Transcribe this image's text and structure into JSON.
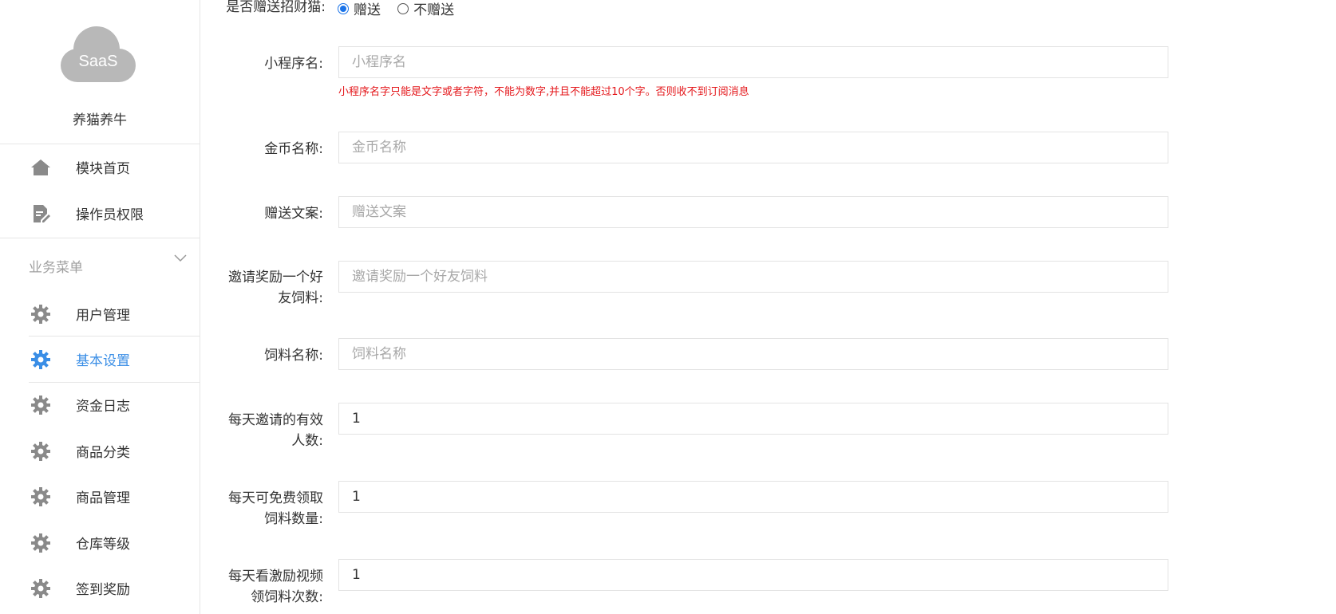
{
  "sidebar": {
    "logo_text": "SaaS",
    "app_name": "养猫养牛",
    "top_items": [
      {
        "label": "模块首页",
        "icon": "home-icon"
      },
      {
        "label": "操作员权限",
        "icon": "document-edit-icon"
      }
    ],
    "group": {
      "label": "业务菜单",
      "icon": "chevron-down-icon"
    },
    "items": [
      {
        "label": "用户管理",
        "icon": "gear-icon",
        "active": false
      },
      {
        "label": "基本设置",
        "icon": "gear-icon",
        "active": true
      },
      {
        "label": "资金日志",
        "icon": "gear-icon",
        "active": false
      },
      {
        "label": "商品分类",
        "icon": "gear-icon",
        "active": false
      },
      {
        "label": "商品管理",
        "icon": "gear-icon",
        "active": false
      },
      {
        "label": "仓库等级",
        "icon": "gear-icon",
        "active": false
      },
      {
        "label": "签到奖励",
        "icon": "gear-icon",
        "active": false
      }
    ],
    "colors": {
      "active": "#3a8ee6",
      "icon": "#8a8a8a"
    }
  },
  "form": {
    "gift": {
      "label": "是否赠送招财猫:",
      "options": [
        "赠送",
        "不赠送"
      ],
      "selected": "赠送"
    },
    "mini_program_name": {
      "label": "小程序名:",
      "placeholder": "小程序名",
      "value": "",
      "hint": "小程序名字只能是文字或者字符，不能为数字,并且不能超过10个字。否则收不到订阅消息"
    },
    "coin_name": {
      "label": "金币名称:",
      "placeholder": "金币名称",
      "value": ""
    },
    "gift_copy": {
      "label": "赠送文案:",
      "placeholder": "赠送文案",
      "value": ""
    },
    "invite_reward": {
      "label_line1": "邀请奖励一个好",
      "label_line2": "友饲料:",
      "placeholder": "邀请奖励一个好友饲料",
      "value": ""
    },
    "feed_name": {
      "label": "饲料名称:",
      "placeholder": "饲料名称",
      "value": ""
    },
    "daily_invites": {
      "label_line1": "每天邀请的有效",
      "label_line2": "人数:",
      "value": "1"
    },
    "daily_free_feed": {
      "label_line1": "每天可免费领取",
      "label_line2": "饲料数量:",
      "value": "1"
    },
    "daily_video_feed": {
      "label_line1": "每天看激励视频",
      "label_line2": "领饲料次数:",
      "value": "1"
    }
  }
}
